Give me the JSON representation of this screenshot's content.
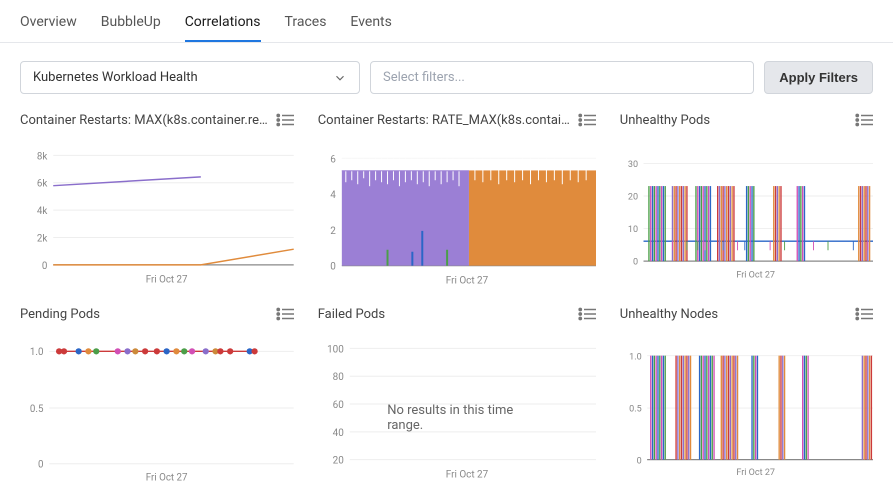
{
  "tabs": [
    "Overview",
    "BubbleUp",
    "Correlations",
    "Traces",
    "Events"
  ],
  "active_tab": 2,
  "dropdown_label": "Kubernetes Workload Health",
  "filters_placeholder": "Select filters...",
  "apply_label": "Apply Filters",
  "no_results": "No results in this time range.",
  "panels": [
    {
      "title": "Container Restarts: MAX(k8s.container.re…",
      "xlabel": "Fri Oct 27"
    },
    {
      "title": "Container Restarts: RATE_MAX(k8s.contai…",
      "xlabel": "Fri Oct 27"
    },
    {
      "title": "Unhealthy Pods",
      "xlabel": "Fri Oct 27"
    },
    {
      "title": "Pending Pods",
      "xlabel": "Fri Oct 27"
    },
    {
      "title": "Failed Pods",
      "xlabel": "Fri Oct 27"
    },
    {
      "title": "Unhealthy Nodes",
      "xlabel": "Fri Oct 27"
    }
  ],
  "chart_data": [
    {
      "type": "line",
      "yticks": [
        "0",
        "2k",
        "4k",
        "6k",
        "8k"
      ],
      "ylim": [
        0,
        8000
      ],
      "xlabel": "Fri Oct 27",
      "series": [
        {
          "name": "purple",
          "color": "#8a6ecb",
          "values": [
            [
              0,
              5800
            ],
            [
              0.6,
              6500
            ]
          ]
        },
        {
          "name": "orange",
          "color": "#e08b3c",
          "values": [
            [
              0,
              0
            ],
            [
              0.6,
              0
            ],
            [
              1,
              950
            ]
          ]
        }
      ]
    },
    {
      "type": "line",
      "yticks": [
        "0",
        "2",
        "4",
        "6"
      ],
      "ylim": [
        0,
        6
      ],
      "xlabel": "Fri Oct 27",
      "series": [
        {
          "name": "purple-fill",
          "type": "area",
          "color": "#9b7fd5",
          "values": 5.3,
          "fill_range": [
            0,
            0.5
          ],
          "top_jitter": true
        },
        {
          "name": "orange-fill",
          "type": "area",
          "color": "#e08b3c",
          "values": 5.3,
          "fill_range": [
            0.5,
            1
          ],
          "top_jitter": true
        },
        {
          "name": "spikes",
          "type": "spikes",
          "colors": [
            "#4b9e48",
            "#2a66c7",
            "#2a66c7",
            "#4b9e48"
          ],
          "spikes": [
            [
              0.18,
              0.9
            ],
            [
              0.28,
              0.8
            ],
            [
              0.32,
              1.9
            ],
            [
              0.42,
              0.9
            ]
          ]
        }
      ]
    },
    {
      "type": "dense_spikes",
      "yticks": [
        "0",
        "10",
        "20",
        "30"
      ],
      "ylim": [
        0,
        30
      ],
      "xlabel": "Fri Oct 27",
      "baseline": 6,
      "spike_top": 23,
      "colors": [
        "#2a66c7",
        "#e08b3c",
        "#4b9e48",
        "#cc3a3a",
        "#d24fb5",
        "#8a6ecb"
      ]
    },
    {
      "type": "dot_line",
      "yticks": [
        "0",
        "0.5",
        "1.0"
      ],
      "ylim": [
        0,
        1
      ],
      "xlabel": "Fri Oct 27",
      "y": 1.0,
      "dot_colors": [
        "#cc3a3a",
        "#2a66c7",
        "#e08b3c",
        "#4b9e48",
        "#d24fb5",
        "#8a6ecb",
        "#cc8a3a",
        "#cc3a3a"
      ]
    },
    {
      "type": "empty",
      "yticks": [
        "20",
        "40",
        "60",
        "80",
        "100"
      ],
      "ylim": [
        0,
        100
      ],
      "xlabel": "Fri Oct 27",
      "message_key": "no_results"
    },
    {
      "type": "dense_spikes",
      "yticks": [
        "0",
        "0.5",
        "1.0"
      ],
      "ylim": [
        0,
        1
      ],
      "xlabel": "Fri Oct 27",
      "baseline": 0,
      "spike_top": 1.0,
      "colors": [
        "#2a66c7",
        "#e08b3c",
        "#4b9e48",
        "#cc3a3a",
        "#d24fb5",
        "#8a6ecb"
      ]
    }
  ]
}
